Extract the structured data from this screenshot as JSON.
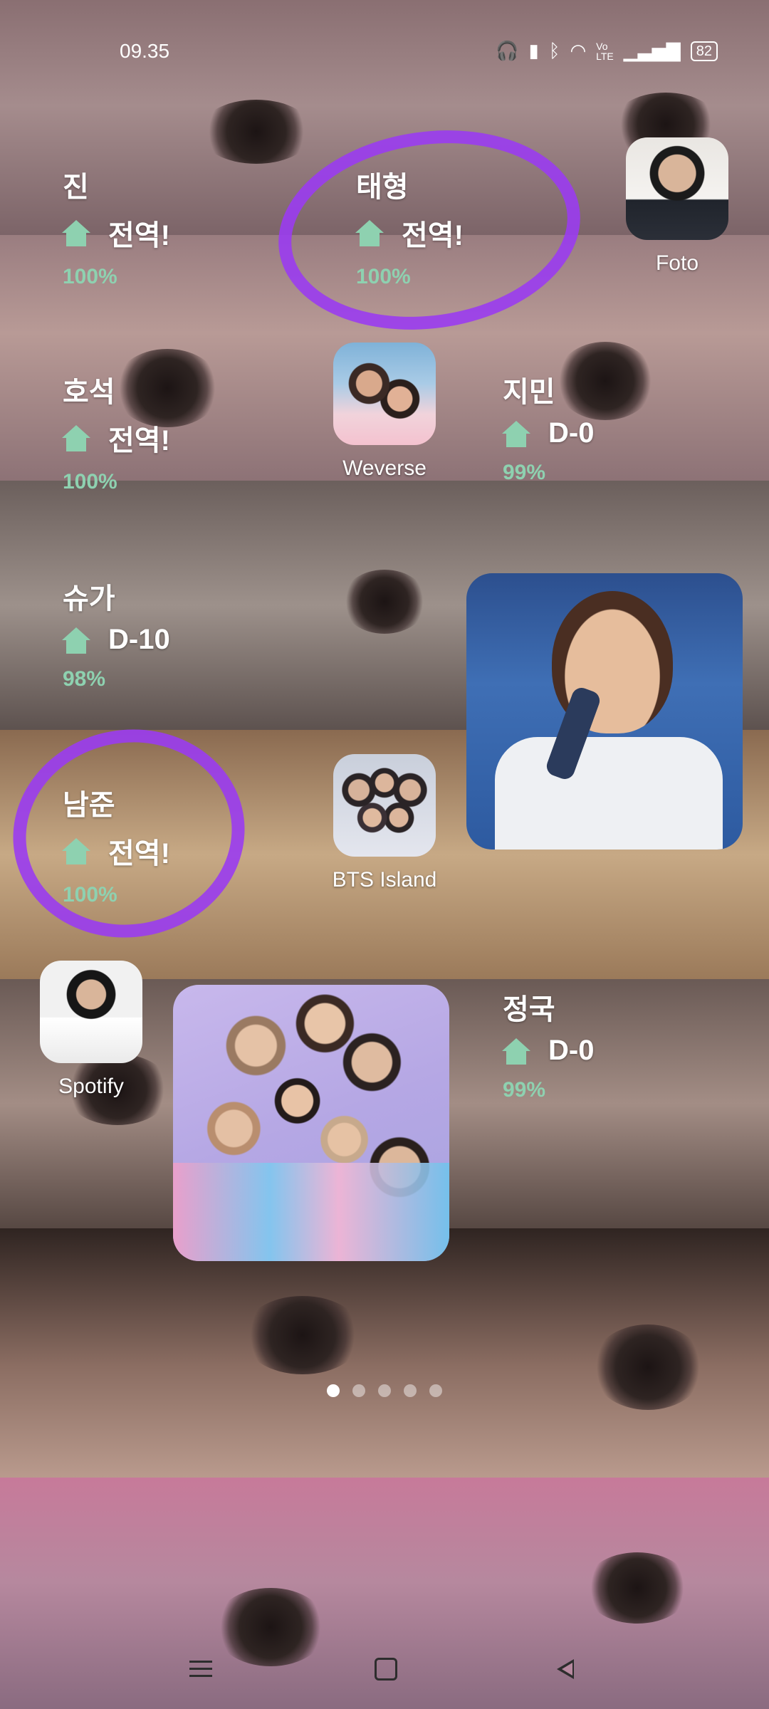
{
  "status_bar": {
    "time": "09.35",
    "battery": "82"
  },
  "widgets": [
    {
      "name": "진",
      "status": "전역!",
      "percent": "100%"
    },
    {
      "name": "태형",
      "status": "전역!",
      "percent": "100%"
    },
    {
      "name": "호석",
      "status": "전역!",
      "percent": "100%"
    },
    {
      "name": "지민",
      "status": "D-0",
      "percent": "99%"
    },
    {
      "name": "슈가",
      "status": "D-10",
      "percent": "98%"
    },
    {
      "name": "남준",
      "status": "전역!",
      "percent": "100%"
    },
    {
      "name": "정국",
      "status": "D-0",
      "percent": "99%"
    }
  ],
  "apps": {
    "foto": "Foto",
    "weverse": "Weverse",
    "bts_island": "BTS Island",
    "spotify": "Spotify"
  },
  "pager": {
    "pages": 5,
    "active": 1
  },
  "colors": {
    "accent_green": "#8ed1b0",
    "scribble_purple": "#9a3cf0"
  }
}
